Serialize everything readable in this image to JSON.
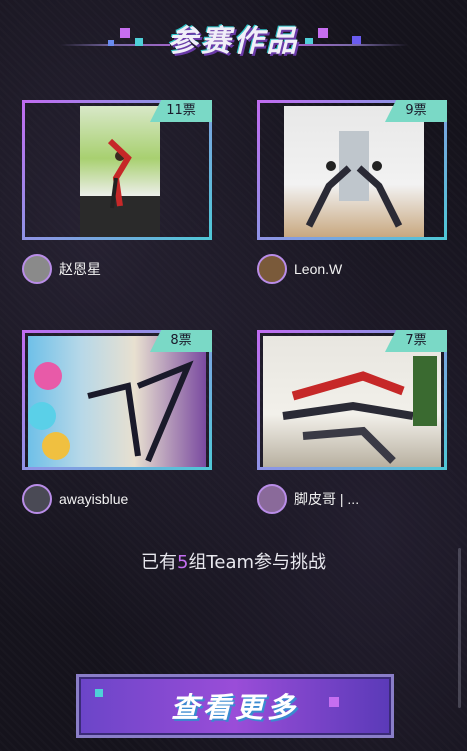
{
  "header": {
    "title": "参赛作品"
  },
  "entries": [
    {
      "votes": "11票",
      "author": "赵恩星"
    },
    {
      "votes": "9票",
      "author": "Leon.W"
    },
    {
      "votes": "8票",
      "author": "awayisblue"
    },
    {
      "votes": "7票",
      "author": "脚皮哥 | ..."
    }
  ],
  "summary": {
    "prefix": "已有",
    "count": "5",
    "suffix": "组Team参与挑战"
  },
  "more_button": {
    "label": "查看更多"
  },
  "colors": {
    "accent_purple": "#c46ef2",
    "vote_tag": "#7ad9c6",
    "border_start": "#c06cf0",
    "border_end": "#4fc7d6"
  }
}
